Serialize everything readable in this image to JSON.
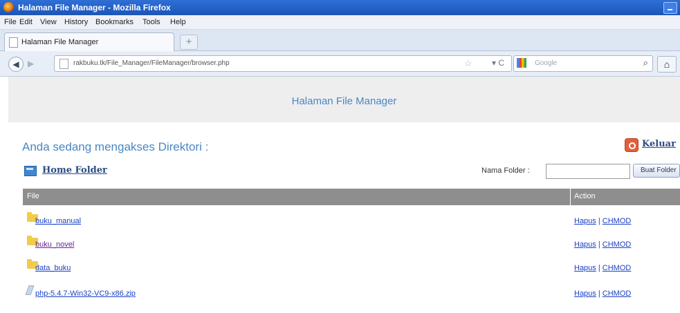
{
  "window": {
    "title": "Halaman File Manager - Mozilla Firefox"
  },
  "menu": {
    "items": [
      "File",
      "Edit",
      "View",
      "History",
      "Bookmarks",
      "Tools",
      "Help"
    ]
  },
  "tab": {
    "title": "Halaman File Manager",
    "new_tab": "+"
  },
  "nav": {
    "back": "◀",
    "forward": "▶",
    "url": "rakbuku.tk/File_Manager/FileManager/browser.php",
    "star": "☆",
    "reload": "▾ C",
    "search_placeholder": "Google",
    "search_icon": "⌕",
    "home": "⌂"
  },
  "page": {
    "header": "Halaman File Manager",
    "dir_title": "Anda sedang mengakses Direktori :",
    "logout": "Keluar",
    "home_folder": "Home Folder",
    "folder_label": "Nama Folder :",
    "folder_input_value": "",
    "create_button": "Buat Folder"
  },
  "table": {
    "headers": {
      "file": "File",
      "action": "Action"
    },
    "action_labels": {
      "delete": "Hapus",
      "chmod": "CHMOD",
      "separator": "|"
    },
    "rows": [
      {
        "name": "buku_manual",
        "type": "folder",
        "visited": false
      },
      {
        "name": "buku_novel",
        "type": "folder",
        "visited": true
      },
      {
        "name": "data_buku",
        "type": "folder",
        "visited": false
      },
      {
        "name": "php-5.4.7-Win32-VC9-x86.zip",
        "type": "file",
        "visited": false
      }
    ]
  }
}
